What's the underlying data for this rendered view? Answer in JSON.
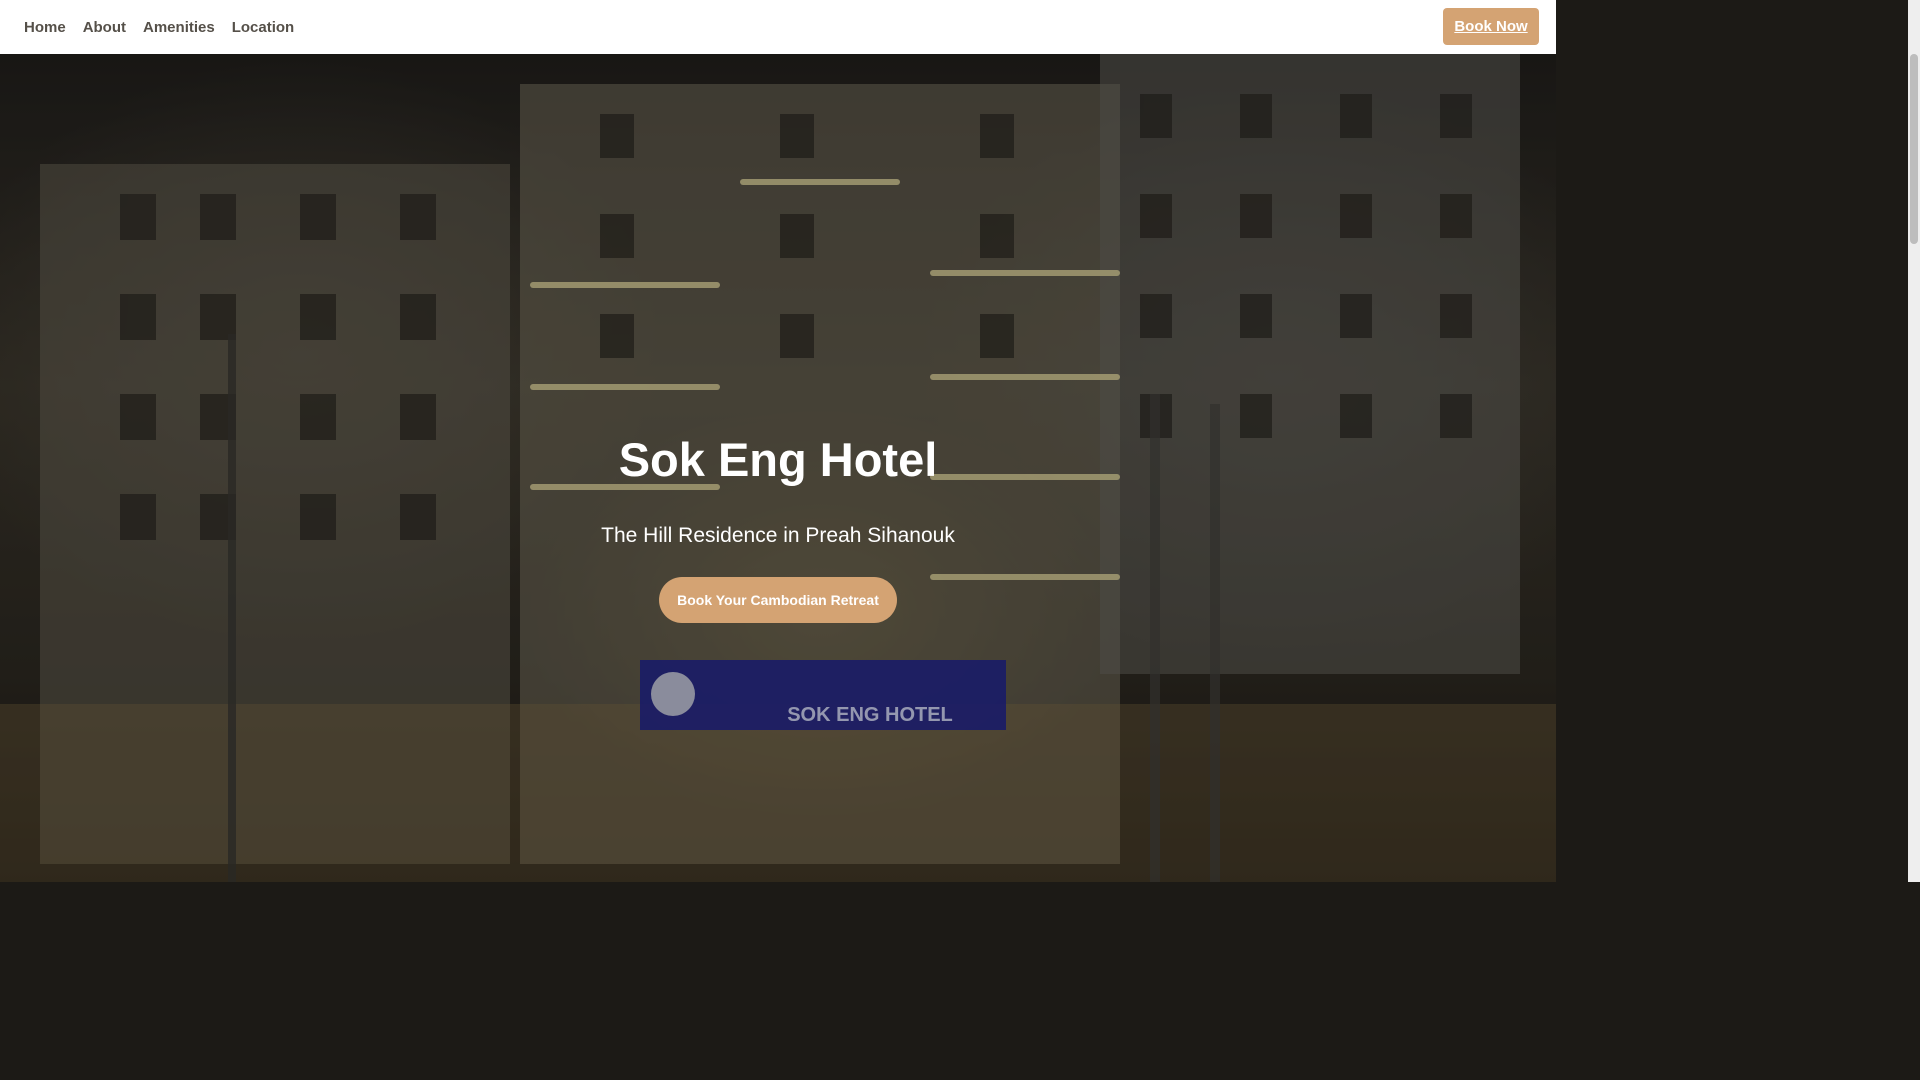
{
  "nav": {
    "links": [
      "Home",
      "About",
      "Amenities",
      "Location"
    ],
    "book_now_label": "Book Now"
  },
  "hero": {
    "title": "Sok Eng Hotel",
    "subtitle": "The Hill Residence in Preah Sihanouk",
    "cta_label": "Book Your Cambodian Retreat",
    "sign_text_latin": "SOK ENG HOTEL",
    "image_description": "night-time facade of a multi-storey hotel with warm lit balconies and a blue neon sign"
  },
  "colors": {
    "accent": "#d4a373",
    "nav_text": "#555049",
    "nav_bg": "#ffffff",
    "hero_text": "#ffffff",
    "sign_neon": "#2c2fa8"
  }
}
